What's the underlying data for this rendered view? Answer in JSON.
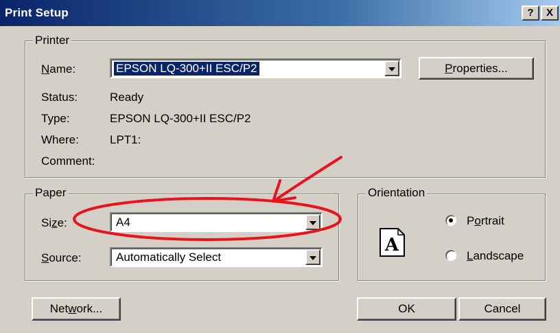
{
  "window": {
    "title": "Print Setup",
    "help_btn": "?",
    "close_btn": "X"
  },
  "printer": {
    "legend": "Printer",
    "name_label": "Name:",
    "name_value": "EPSON LQ-300+II ESC/P2",
    "properties_button": "Properties...",
    "status_label": "Status:",
    "status_value": "Ready",
    "type_label": "Type:",
    "type_value": "EPSON LQ-300+II ESC/P2",
    "where_label": "Where:",
    "where_value": "LPT1:",
    "comment_label": "Comment:"
  },
  "paper": {
    "legend": "Paper",
    "size_label": "Size:",
    "size_value": "A4",
    "source_label": "Source:",
    "source_value": "Automatically Select"
  },
  "orientation": {
    "legend": "Orientation",
    "portrait": "Portrait",
    "landscape": "Landscape",
    "selected": "portrait",
    "preview_glyph": "A"
  },
  "buttons": {
    "network": "Network...",
    "ok": "OK",
    "cancel": "Cancel"
  },
  "annotation": {
    "color": "#e8141c"
  }
}
